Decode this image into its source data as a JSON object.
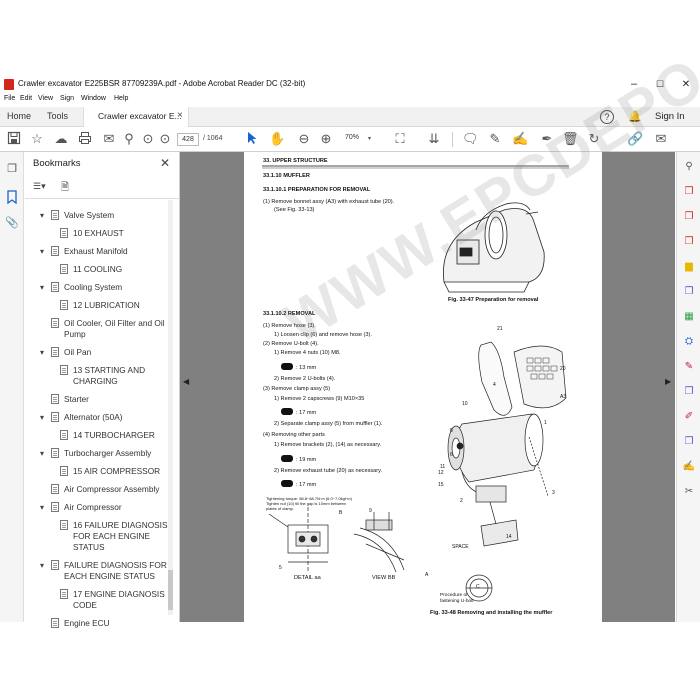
{
  "window": {
    "title": "Crawler excavator E225BSR 87709239A.pdf - Adobe Acrobat Reader DC (32-bit)",
    "minimize": "–",
    "maximize": "☐",
    "close": "✕"
  },
  "menu": [
    "File",
    "Edit",
    "View",
    "Sign",
    "Window",
    "Help"
  ],
  "tabs": {
    "home": "Home",
    "tools": "Tools",
    "document": "Crawler excavator E...",
    "close": "×",
    "help": "?",
    "sign_in": "Sign In"
  },
  "toolbar": {
    "page_current": "428",
    "page_total": "/ 1064",
    "zoom": "70%"
  },
  "bookmarks": {
    "header": "Bookmarks",
    "close": "✕",
    "items": [
      {
        "label": "Valve System",
        "chevron": true,
        "level": 1
      },
      {
        "label": "10 EXHAUST",
        "chevron": false,
        "level": 2
      },
      {
        "label": "Exhaust Manifold",
        "chevron": true,
        "level": 1
      },
      {
        "label": "11 COOLING",
        "chevron": false,
        "level": 2
      },
      {
        "label": "Cooling System",
        "chevron": true,
        "level": 1
      },
      {
        "label": "12 LUBRICATION",
        "chevron": false,
        "level": 2
      },
      {
        "label": "Oil Cooler, Oil Filter and Oil",
        "label2": "Pump",
        "chevron": false,
        "level": 1
      },
      {
        "label": "Oil Pan",
        "chevron": true,
        "level": 1
      },
      {
        "label": "13 STARTING AND",
        "label2": "CHARGING",
        "chevron": false,
        "level": 2
      },
      {
        "label": "Starter",
        "chevron": false,
        "level": 1
      },
      {
        "label": "Alternator (50A)",
        "chevron": true,
        "level": 1
      },
      {
        "label": "14 TURBOCHARGER",
        "chevron": false,
        "level": 2
      },
      {
        "label": "Turbocharger Assembly",
        "chevron": true,
        "level": 1
      },
      {
        "label": "15 AIR COMPRESSOR",
        "chevron": false,
        "level": 2
      },
      {
        "label": "Air Compressor Assembly",
        "chevron": false,
        "level": 1
      },
      {
        "label": "Air Compressor",
        "chevron": true,
        "level": 1
      },
      {
        "label": "16 FAILURE DIAGNOSIS",
        "label2": "FOR EACH ENGINE",
        "label3": "STATUS",
        "chevron": false,
        "level": 2
      },
      {
        "label": "FAILURE DIAGNOSIS FOR",
        "label2": "EACH ENGINE STATUS",
        "chevron": true,
        "level": 1
      },
      {
        "label": "17 ENGINE DIAGNOSIS",
        "label2": "CODE",
        "chevron": false,
        "level": 2
      },
      {
        "label": "Engine ECU",
        "chevron": false,
        "level": 1
      }
    ]
  },
  "document": {
    "section": "33. UPPER STRUCTURE",
    "h1": "33.1.10      MUFFLER",
    "h2": "33.1.10.1      PREPARATION FOR REMOVAL",
    "prep1": "(1)  Remove bonnet assy (A3) with exhaust tube (20).",
    "prep2": "(See Fig. 33-13)",
    "fig47": "Fig. 33-47 Preparation for removal",
    "h3": "33.1.10.2      REMOVAL",
    "steps": [
      "(1)  Remove hose (3).",
      "1) Loosen clip (6) and remove hose (3).",
      "(2)  Remove U-bolt (4).",
      "1) Remove 4 nuts (10) M8.",
      ": 13 mm",
      "2) Remove 2 U-bolts (4).",
      "(3)  Remove clamp assy (5)",
      "1) Remove 2 capscrews (9) M10×35",
      ": 17 mm",
      "2) Separate clamp assy (5) from muffler (1).",
      "(4)  Removing other parts",
      "1) Remove brackets (2), (14) as necessary.",
      ": 19 mm",
      "2) Remove exhaust tube (20) as necessary.",
      ": 17 mm"
    ],
    "torque1": "Tightening torque: 58.8~68.7N·m (6.0~7.0kgf·m)",
    "torque2": "Tighten nut (10) till the gap is 10mm between",
    "torque3": "plates of clamp.",
    "detail_aa": "DETAIL aa",
    "view_bb": "VIEW BB",
    "space": "SPACE",
    "procedure1": "Procedure of",
    "procedure2": "fastening U-bolt",
    "fig48": "Fig. 33-48 Removing and installing the muffler",
    "callouts": [
      "21",
      "20",
      "A3",
      "4",
      "1",
      "10",
      "8",
      "11",
      "12",
      "15",
      "6",
      "2",
      "3",
      "14",
      "9",
      "5",
      "B",
      "A",
      "C"
    ],
    "watermark": "WWW.EPCDEPO.COM"
  }
}
